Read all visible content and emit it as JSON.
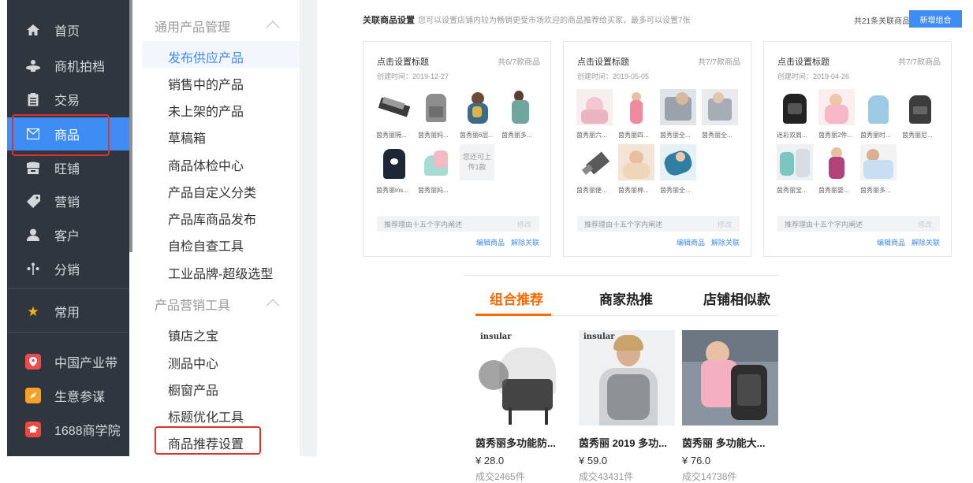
{
  "nav": {
    "items": [
      {
        "label": "首页",
        "icon": "home-icon"
      },
      {
        "label": "商机拍档",
        "icon": "partner-icon"
      },
      {
        "label": "交易",
        "icon": "clipboard-icon"
      },
      {
        "label": "商品",
        "icon": "mail-icon"
      },
      {
        "label": "旺铺",
        "icon": "shop-icon"
      },
      {
        "label": "营销",
        "icon": "tag-icon"
      },
      {
        "label": "客户",
        "icon": "user-icon"
      },
      {
        "label": "分销",
        "icon": "share-icon"
      },
      {
        "label": "常用",
        "icon": "star-icon"
      },
      {
        "label": "中国产业带",
        "icon": "location-app-icon"
      },
      {
        "label": "生意参谋",
        "icon": "compass-app-icon"
      },
      {
        "label": "1688商学院",
        "icon": "school-app-icon"
      }
    ],
    "active_index": 3
  },
  "submenu": {
    "group1": "通用产品管理",
    "group1_items": [
      "发布供应产品",
      "销售中的产品",
      "未上架的产品",
      "草稿箱",
      "商品体检中心",
      "产品自定义分类",
      "产品库商品发布",
      "自检自查工具",
      "工业品牌-超级选型"
    ],
    "group2": "产品营销工具",
    "group2_items": [
      "镇店之宝",
      "测品中心",
      "橱窗产品",
      "标题优化工具",
      "商品推荐设置"
    ]
  },
  "header": {
    "title": "关联商品设置",
    "subtitle": "您可以设置店铺内较为畅销更受市场欢迎的商品推荐给买家，最多可以设置7张",
    "count": "共21条关联商品",
    "new_button": "新增组合"
  },
  "cards": [
    {
      "title": "点击设置标题",
      "count": "共6/7款商品",
      "date": "创建时间：2019-12-27",
      "items": [
        "茵秀丽隔...",
        "茵秀丽妈...",
        "茵秀丽6层...",
        "茵秀丽多...",
        "茵秀丽ins...",
        "茵秀丽妈..."
      ],
      "upload": "您还可上传1款",
      "reason": "推荐理由十五个字内阐述",
      "reason_edit": "修改",
      "edit": "编辑商品",
      "unlink": "解除关联"
    },
    {
      "title": "点击设置标题",
      "count": "共7/7款商品",
      "date": "创建时间：2019-05-05",
      "items": [
        "茵秀丽六...",
        "茵秀丽四...",
        "茵秀丽全...",
        "茵秀丽全...",
        "茵秀丽便...",
        "茵秀丽棉...",
        "茵秀丽全..."
      ],
      "reason": "推荐理由十五个字内阐述",
      "reason_edit": "修改",
      "edit": "编辑商品",
      "unlink": "解除关联"
    },
    {
      "title": "点击设置标题",
      "count": "共7/7款商品",
      "date": "创建时间：2019-04-26",
      "items": [
        "迷彩双肩...",
        "茵秀丽2件...",
        "茵秀丽时...",
        "茵秀丽尼...",
        "茵秀丽宝...",
        "茵秀丽婴...",
        "茵秀丽多..."
      ],
      "reason": "推荐理由十五个字内阐述",
      "reason_edit": "修改",
      "edit": "编辑商品",
      "unlink": "解除关联"
    }
  ],
  "recommend": {
    "tabs": [
      "组合推荐",
      "商家热推",
      "店铺相似款"
    ],
    "active_tab": 0,
    "brand": "insular",
    "products": [
      {
        "name": "茵秀丽多功能防...",
        "price": "¥ 28.0",
        "sold": "成交2465件"
      },
      {
        "name": "茵秀丽 2019 多功...",
        "price": "¥ 59.0",
        "sold": "成交43431件"
      },
      {
        "name": "茵秀丽 多功能大...",
        "price": "¥ 76.0",
        "sold": "成交14738件"
      }
    ]
  },
  "colors": {
    "nav_bg": "#2f3640",
    "accent_blue": "#3d8df5",
    "accent_orange": "#ff6a00",
    "highlight_red": "#e0312d"
  }
}
